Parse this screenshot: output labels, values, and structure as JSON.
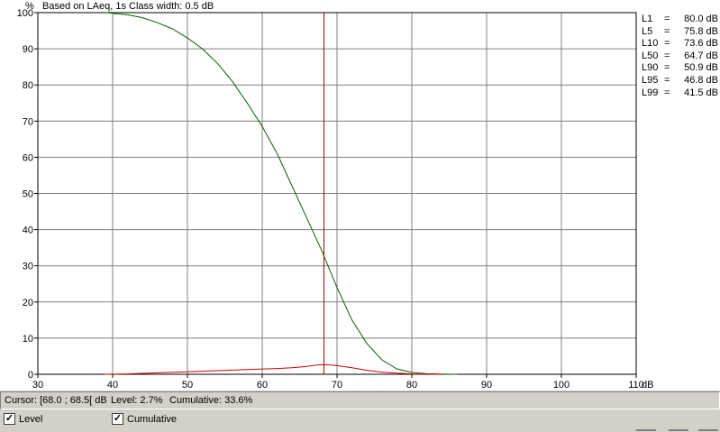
{
  "header": {
    "unit_label": "%",
    "info": "Based on LAeq, 1s   Class width: 0.5 dB"
  },
  "percentiles": [
    {
      "name": "L1",
      "eq": "=",
      "value": "80.0 dB"
    },
    {
      "name": "L5",
      "eq": "=",
      "value": "75.8 dB"
    },
    {
      "name": "L10",
      "eq": "=",
      "value": "73.6 dB"
    },
    {
      "name": "L50",
      "eq": "=",
      "value": "64.7 dB"
    },
    {
      "name": "L90",
      "eq": "=",
      "value": "50.9 dB"
    },
    {
      "name": "L95",
      "eq": "=",
      "value": "46.8 dB"
    },
    {
      "name": "L99",
      "eq": "=",
      "value": "41.5 dB"
    }
  ],
  "status": {
    "cursor": "Cursor: [68.0 ; 68.5[ dB",
    "level": "Level: 2.7%",
    "cumulative": "Cumulative: 33.6%"
  },
  "legend": {
    "level_label": "Level",
    "cumulative_label": "Cumulative",
    "level_checked": true,
    "cumulative_checked": true,
    "check_glyph": "✓"
  },
  "colors": {
    "level": "#cc0000",
    "cumulative": "#006600",
    "cursor": "#aa0000",
    "grid": "#808080"
  },
  "chart_data": {
    "type": "line",
    "xlabel": "dB",
    "ylabel": "%",
    "xlim": [
      30,
      110
    ],
    "ylim": [
      0,
      100
    ],
    "x_ticks": [
      30,
      40,
      50,
      60,
      70,
      80,
      90,
      100,
      110
    ],
    "y_ticks": [
      0,
      10,
      20,
      30,
      40,
      50,
      60,
      70,
      80,
      90,
      100
    ],
    "cursor_x": 68.25,
    "series": [
      {
        "name": "Cumulative",
        "color": "#006600",
        "x": [
          39,
          40,
          42,
          44,
          46,
          48,
          50,
          52,
          54,
          56,
          58,
          60,
          62,
          64,
          66,
          68,
          70,
          72,
          74,
          76,
          78,
          80,
          82,
          84,
          86
        ],
        "y": [
          100,
          99.8,
          99.4,
          98.6,
          97.2,
          95.5,
          93,
          90,
          86,
          81,
          75,
          68.5,
          61,
          52,
          43,
          34,
          24,
          15,
          8.5,
          4,
          1.5,
          0.5,
          0.15,
          0.05,
          0
        ]
      },
      {
        "name": "Level",
        "color": "#cc0000",
        "x": [
          39,
          42,
          46,
          50,
          54,
          58,
          62,
          64,
          66,
          67,
          68,
          69,
          70,
          72,
          74,
          76,
          78,
          80,
          82,
          84
        ],
        "y": [
          0,
          0.1,
          0.4,
          0.7,
          1,
          1.3,
          1.6,
          1.8,
          2.2,
          2.5,
          2.7,
          2.6,
          2.4,
          1.8,
          1.1,
          0.6,
          0.3,
          0.1,
          0.05,
          0
        ]
      }
    ]
  }
}
